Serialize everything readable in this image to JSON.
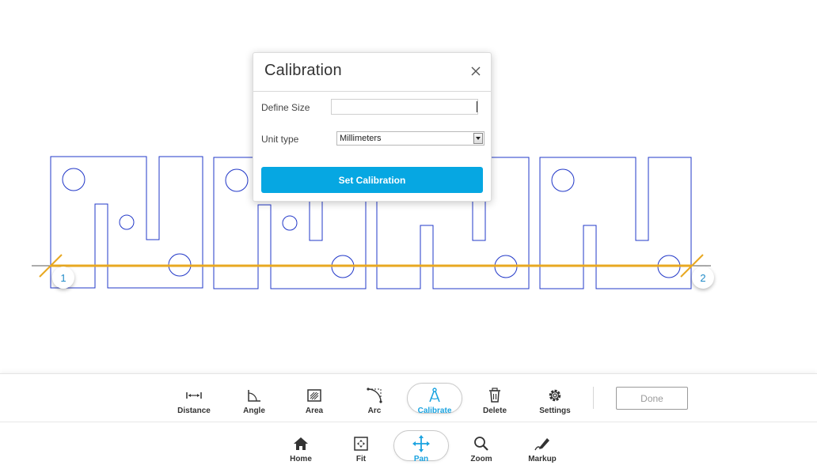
{
  "calibration_dialog": {
    "title": "Calibration",
    "define_size_label": "Define Size",
    "define_size_value": "",
    "unit_type_label": "Unit type",
    "unit_type_value": "Millimeters",
    "set_button_label": "Set Calibration",
    "close_icon": "close-icon"
  },
  "markers": {
    "point_1": "1",
    "point_2": "2"
  },
  "measure_toolbar": {
    "tools": [
      {
        "label": "Distance",
        "icon": "distance-icon"
      },
      {
        "label": "Angle",
        "icon": "angle-icon"
      },
      {
        "label": "Area",
        "icon": "area-icon"
      },
      {
        "label": "Arc",
        "icon": "arc-icon"
      },
      {
        "label": "Calibrate",
        "icon": "calibrate-icon",
        "active": true
      },
      {
        "label": "Delete",
        "icon": "trash-icon"
      },
      {
        "label": "Settings",
        "icon": "gear-icon"
      }
    ],
    "done_label": "Done"
  },
  "nav_toolbar": {
    "tools": [
      {
        "label": "Home",
        "icon": "home-icon"
      },
      {
        "label": "Fit",
        "icon": "fit-icon"
      },
      {
        "label": "Pan",
        "icon": "pan-icon",
        "active": true
      },
      {
        "label": "Zoom",
        "icon": "zoom-icon"
      },
      {
        "label": "Markup",
        "icon": "markup-icon"
      }
    ]
  },
  "colors": {
    "accent": "#06a7e2",
    "drawing_line": "#2238c8",
    "calibration_line": "#e8a821"
  }
}
